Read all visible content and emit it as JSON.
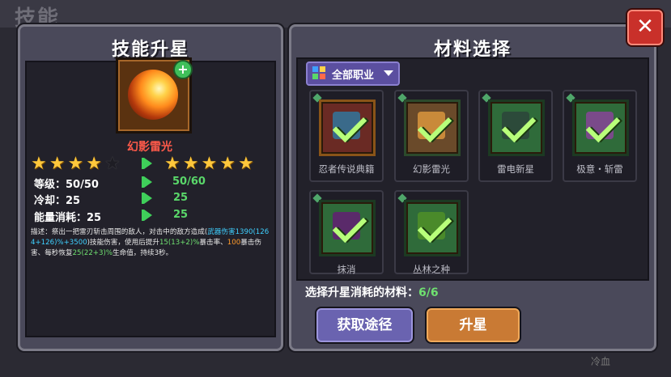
{
  "background": {
    "title": "技能",
    "corner_label": "冷血"
  },
  "left_panel": {
    "title": "技能升星",
    "skill_name": "幻影雷光",
    "current_stars": 4,
    "next_stars": 5,
    "total_stars": 5,
    "stats": [
      {
        "label": "等级：",
        "current": "50/50",
        "next": "50/60"
      },
      {
        "label": "冷却：",
        "current": "25",
        "next": "25"
      },
      {
        "label": "能量消耗：",
        "current": "25",
        "next": "25"
      }
    ],
    "description": {
      "p1": "描述：祭出一把雷刃斩击周围的敌人，对击中的敌方造成(",
      "h1": "武器伤害1390(1264+126)%+3500",
      "p2": ")技能伤害，使用后提升",
      "h2": "15(13+2)%",
      "p3": "暴击率、",
      "h3": "100",
      "p4": "暴击伤害、每秒恢复",
      "h4": "25(22+3)%",
      "p5": "生命值，持续3秒。"
    }
  },
  "right_panel": {
    "title": "材料选择",
    "filter_label": "全部职业",
    "materials": [
      {
        "label": "忍者传说典籍"
      },
      {
        "label": "幻影雷光"
      },
      {
        "label": "雷电新星"
      },
      {
        "label": "极意・斩雷"
      },
      {
        "label": "抹消"
      },
      {
        "label": "丛林之种"
      }
    ],
    "summary_label": "选择升星消耗的材料：",
    "summary_count": "6/6",
    "get_button": "获取途径",
    "upgrade_button": "升星",
    "close_button": "✕"
  },
  "colors": {
    "accent_green": "#6fe070",
    "skill_name_red": "#ff5a4a",
    "highlight_cyan": "#3fd0ff",
    "close_red": "#c9302a"
  }
}
